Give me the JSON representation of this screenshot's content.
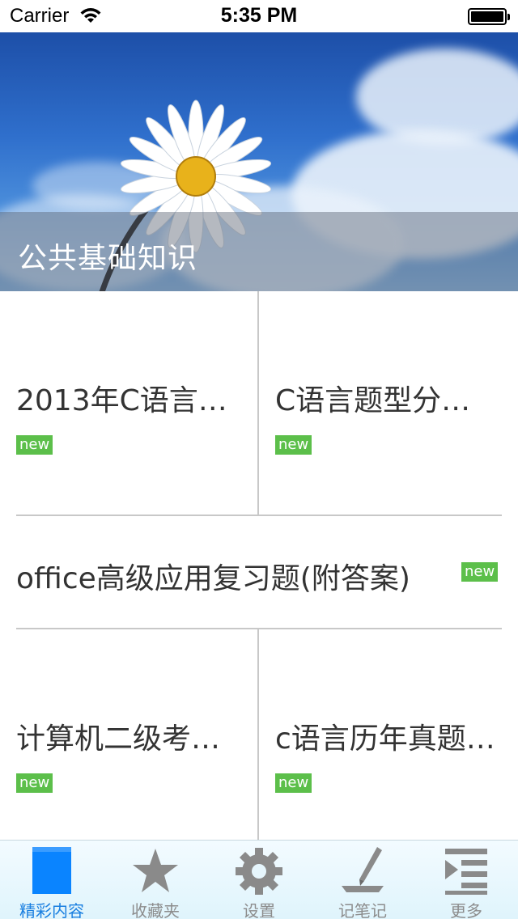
{
  "status_bar": {
    "carrier": "Carrier",
    "time": "5:35 PM"
  },
  "banner": {
    "title": "公共基础知识"
  },
  "tiles": [
    {
      "title": "2013年C语言…",
      "badge": "new"
    },
    {
      "title": "C语言题型分…",
      "badge": "new"
    },
    {
      "title": "office高级应用复习题(附答案)",
      "badge": "new"
    },
    {
      "title": "计算机二级考…",
      "badge": "new"
    },
    {
      "title": "c语言历年真题…",
      "badge": "new"
    }
  ],
  "tab_bar": {
    "items": [
      {
        "label": "精彩内容",
        "icon": "book-icon",
        "active": true
      },
      {
        "label": "收藏夹",
        "icon": "star-icon",
        "active": false
      },
      {
        "label": "设置",
        "icon": "gear-icon",
        "active": false
      },
      {
        "label": "记笔记",
        "icon": "pen-icon",
        "active": false
      },
      {
        "label": "更多",
        "icon": "list-icon",
        "active": false
      }
    ]
  },
  "colors": {
    "badge": "#5cbf4a",
    "active_tab": "#1a7fe0",
    "inactive_tab": "#8c8c8c"
  }
}
